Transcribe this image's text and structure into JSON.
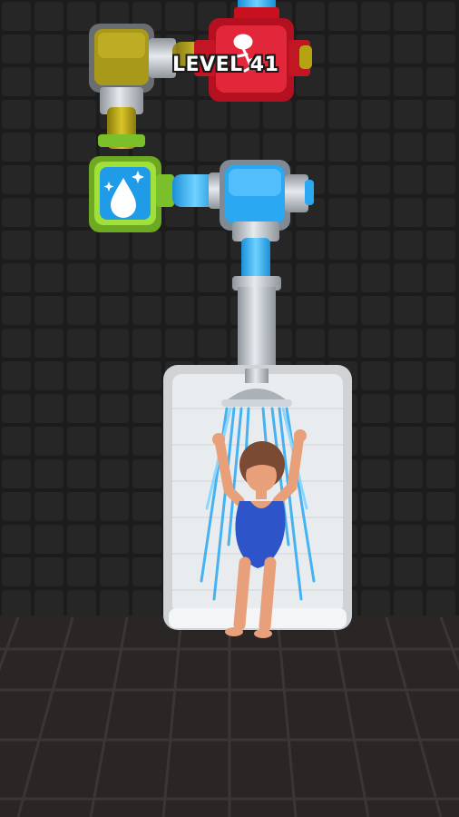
{
  "hud": {
    "level_text": "LEVEL 41"
  },
  "colors": {
    "wall": "#1c1c1c",
    "floor": "#2a2626",
    "dirty_water": "#b5a313",
    "clean_water": "#2fa9f0",
    "yellow_valve": "#c8d42a",
    "green_valve": "#8ed630",
    "red_valve": "#d91e2e",
    "pipe_metal": "#c9cfd6"
  },
  "valves": [
    {
      "id": "dirty",
      "fill": "dirty-water",
      "icon": "none"
    },
    {
      "id": "red",
      "fill": "dirty-water",
      "icon": "bacteria-icon"
    },
    {
      "id": "green",
      "fill": "clean-water",
      "icon": "water-drop-sparkle-icon"
    },
    {
      "id": "blue",
      "fill": "clean-water",
      "icon": "none"
    }
  ],
  "character": {
    "state": "showering"
  }
}
